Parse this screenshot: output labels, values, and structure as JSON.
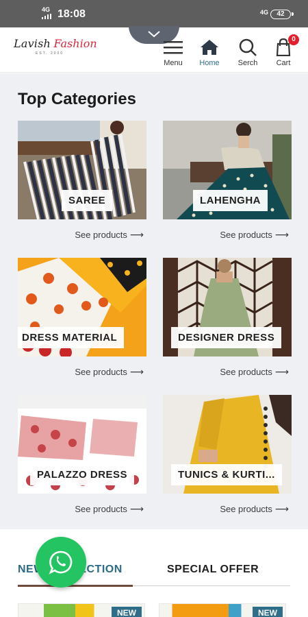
{
  "status_bar": {
    "time": "18:08",
    "network_left": "4G",
    "network_right": "4G",
    "battery": "42"
  },
  "header": {
    "logo_main": "Lavish",
    "logo_accent": "Fashion",
    "logo_sub": "EST. 2000",
    "nav": [
      {
        "label": "Menu",
        "icon": "menu-icon"
      },
      {
        "label": "Home",
        "icon": "home-icon"
      },
      {
        "label": "Serch",
        "icon": "search-icon"
      },
      {
        "label": "Cart",
        "icon": "cart-icon"
      }
    ],
    "cart_count": "0"
  },
  "main": {
    "section_title": "Top Categories",
    "categories": [
      {
        "label": "SAREE",
        "see": "See products"
      },
      {
        "label": "LAHENGHA",
        "see": "See products"
      },
      {
        "label": "DRESS MATERIAL",
        "see": "See products"
      },
      {
        "label": "DESIGNER DRESS",
        "see": "See products"
      },
      {
        "label": "PALAZZO DRESS",
        "see": "See products"
      },
      {
        "label": "TUNICS & KURTI...",
        "see": "See products"
      }
    ]
  },
  "tabs": {
    "new_collection": "NEW COLLECTION",
    "special_offer": "SPECIAL OFFER"
  },
  "products": [
    {
      "badge": "NEW"
    },
    {
      "badge": "NEW"
    }
  ],
  "colors": {
    "accent": "#2f6e8a",
    "cart_badge": "#e41e2b",
    "whatsapp": "#25c463",
    "tab_underline": "#6d4b3a"
  }
}
